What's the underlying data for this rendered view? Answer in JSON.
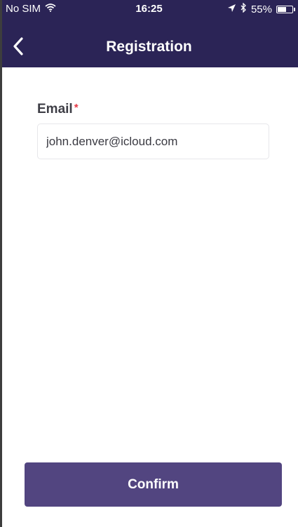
{
  "status_bar": {
    "carrier": "No SIM",
    "time": "16:25",
    "battery": "55%",
    "battery_level": 0.55,
    "icons": [
      "wifi-icon",
      "location-arrow-icon",
      "bluetooth-icon",
      "battery-icon"
    ]
  },
  "nav": {
    "title": "Registration",
    "back_icon": "chevron-left-icon"
  },
  "form": {
    "email_label": "Email",
    "required_marker": "*",
    "email_value": "john.denver@icloud.com"
  },
  "actions": {
    "confirm_label": "Confirm"
  },
  "colors": {
    "header_bg": "#2b2456",
    "button_bg": "#524580",
    "required": "#e63946",
    "label_text": "#3e3e46"
  }
}
